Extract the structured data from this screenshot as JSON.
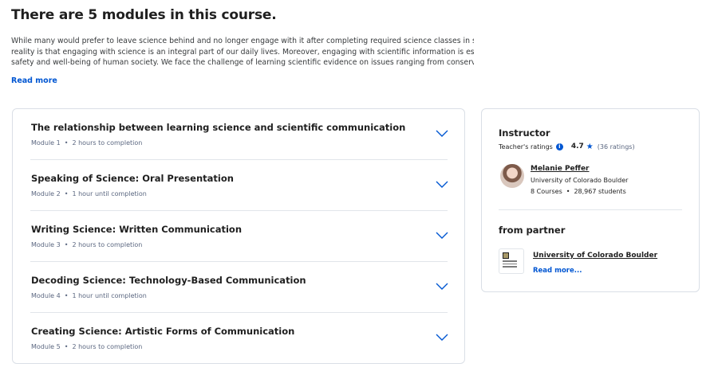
{
  "heading": "There are 5 modules in this course.",
  "description_lines": [
    "While many would prefer to leave science behind and no longer engage with it after completing required science classes in school, the",
    "reality is that engaging with science is an integral part of our daily lives. Moreover, engaging with scientific information is essential to the",
    "safety and well-being of human society. We face the challenge of learning scientific evidence on issues ranging from conservation to"
  ],
  "read_more": "Read more",
  "modules": [
    {
      "title": "The relationship between learning science and scientific communication",
      "number": "Module 1",
      "duration": "2 hours to completion"
    },
    {
      "title": "Speaking of Science: Oral Presentation",
      "number": "Module 2",
      "duration": "1 hour until completion"
    },
    {
      "title": "Writing Science: Written Communication",
      "number": "Module 3",
      "duration": "2 hours to completion"
    },
    {
      "title": "Decoding Science: Technology-Based Communication",
      "number": "Module 4",
      "duration": "1 hour until completion"
    },
    {
      "title": "Creating Science: Artistic Forms of Communication",
      "number": "Module 5",
      "duration": "2 hours to completion"
    }
  ],
  "meta_separator": "•",
  "instructor": {
    "section_title": "Instructor",
    "ratings_label": "Teacher's ratings",
    "info_icon": "i",
    "rating": "4.7",
    "star_icon": "★",
    "rating_count": "(36 ratings)",
    "name": "Melanie Peffer",
    "organization": "University of Colorado Boulder",
    "courses": "8 Courses",
    "students": "28,967 students"
  },
  "partner": {
    "section_title": "from partner",
    "name": "University of Colorado Boulder",
    "read_more": "Read more..."
  },
  "colors": {
    "link_blue": "#0056d2",
    "border": "#dadfe6",
    "muted_text": "#5b6780"
  }
}
